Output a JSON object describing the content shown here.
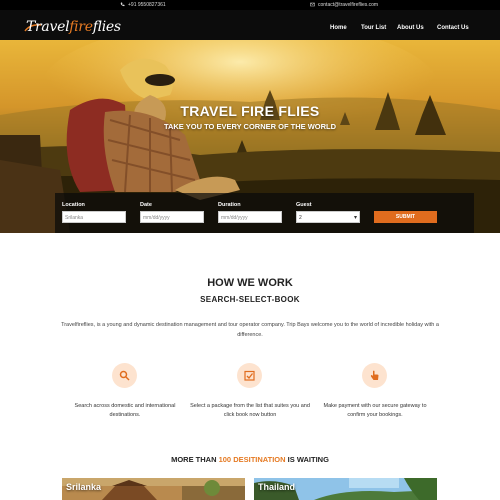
{
  "topbar": {
    "phone": "+91 9550827361",
    "email": "contact@travelfireflies.com"
  },
  "brand": {
    "part1": "Travel",
    "part2": "fire",
    "part3": "flies",
    "accent": "#e57a23"
  },
  "nav": {
    "items": [
      "Home",
      "Tour List",
      "About Us",
      "Contact Us"
    ]
  },
  "hero": {
    "title": "TRAVEL FIRE FLIES",
    "subtitle": "TAKE YOU TO EVERY CORNER OF THE WORLD"
  },
  "search": {
    "location_label": "Location",
    "location_value": "Srilanka",
    "date_label": "Date",
    "date_placeholder": "mm/dd/yyyy",
    "duration_label": "Duration",
    "duration_placeholder": "mm/dd/yyyy",
    "guest_label": "Guest",
    "guest_value": "2",
    "submit_label": "SUBMIT"
  },
  "how": {
    "title": "HOW WE WORK",
    "subtitle": "SEARCH-SELECT-BOOK",
    "intro": "Travelfireflies, is a young and dynamic destination management and tour operator company. Trip Bays welcome you to the world of incredible holiday with a difference.",
    "steps": [
      {
        "icon": "search-icon",
        "text": "Search across domestic and international destinations."
      },
      {
        "icon": "checklist-icon",
        "text": "Select a package from the list that suites you and click book now button"
      },
      {
        "icon": "hand-pointer-icon",
        "text": "Make payment with our secure gateway to confirm your bookings."
      }
    ]
  },
  "destinations": {
    "prefix": "MORE THAN",
    "highlight": "100 DESITINATION",
    "suffix": "IS WAITING",
    "cards": [
      "Srilanka",
      "Thailand"
    ]
  },
  "colors": {
    "accent": "#e06c1e",
    "icon_bg": "#fde3cf",
    "dark": "#0c0c0c"
  }
}
